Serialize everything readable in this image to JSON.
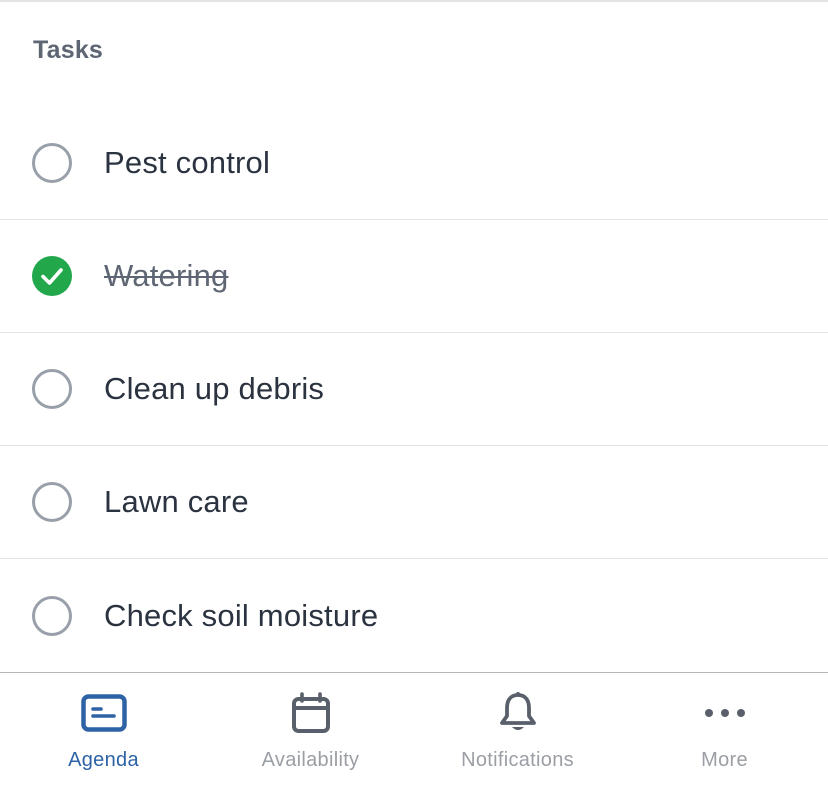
{
  "section": {
    "title": "Tasks"
  },
  "tasks": [
    {
      "label": "Pest control",
      "done": false
    },
    {
      "label": "Watering",
      "done": true
    },
    {
      "label": "Clean up debris",
      "done": false
    },
    {
      "label": "Lawn care",
      "done": false
    },
    {
      "label": "Check soil moisture",
      "done": false
    }
  ],
  "tab_bar": {
    "tabs": [
      {
        "label": "Agenda",
        "icon": "agenda-icon",
        "active": true
      },
      {
        "label": "Availability",
        "icon": "calendar-icon",
        "active": false
      },
      {
        "label": "Notifications",
        "icon": "bell-icon",
        "active": false
      },
      {
        "label": "More",
        "icon": "more-dots-icon",
        "active": false
      }
    ]
  },
  "colors": {
    "accent": "#2d63a4",
    "done_green": "#22a84a",
    "icon_gray": "#5a606b",
    "inactive_label": "#9b9ea4"
  }
}
